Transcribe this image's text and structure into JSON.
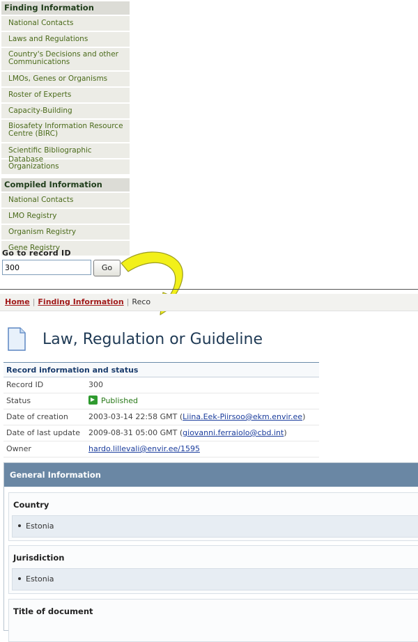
{
  "sidebar": {
    "finding_header": "Finding Information",
    "finding_items": [
      "National Contacts",
      "Laws and Regulations",
      "Country's Decisions and other Communications",
      "LMOs, Genes or Organisms",
      "Roster of Experts",
      "Capacity-Building",
      "Biosafety Information Resource Centre (BIRC)",
      "Scientific Bibliographic Database",
      "Organizations"
    ],
    "compiled_header": "Compiled Information",
    "compiled_items": [
      "National Contacts",
      "LMO Registry",
      "Organism Registry",
      "Gene Registry"
    ]
  },
  "goto": {
    "label": "Go to record ID",
    "value": "300",
    "button": "Go"
  },
  "breadcrumb": {
    "home": "Home",
    "finding": "Finding Information",
    "current": "Reco"
  },
  "page": {
    "title": "Law, Regulation or Guideline"
  },
  "record": {
    "header": "Record information and status",
    "rows": [
      {
        "label": "Record ID",
        "value": "300"
      },
      {
        "label": "Status",
        "value": "Published"
      },
      {
        "label": "Date of creation",
        "value": "2003-03-14 22:58 GMT",
        "link": "Liina.Eek-Piirsoo@ekm.envir.ee"
      },
      {
        "label": "Date of last update",
        "value": "2009-08-31 05:00 GMT",
        "link": "giovanni.ferraiolo@cbd.int"
      },
      {
        "label": "Owner",
        "link": "hardo.lillevali@envir.ee/1595"
      }
    ]
  },
  "general": {
    "header": "General Information",
    "fields": [
      {
        "title": "Country",
        "value": "Estonia"
      },
      {
        "title": "Jurisdiction",
        "value": "Estonia"
      },
      {
        "title": "Title of document"
      }
    ]
  },
  "colors": {
    "arrow": "#f2f01a",
    "link_red": "#a11b1b",
    "section_blue": "#6a87a4"
  }
}
